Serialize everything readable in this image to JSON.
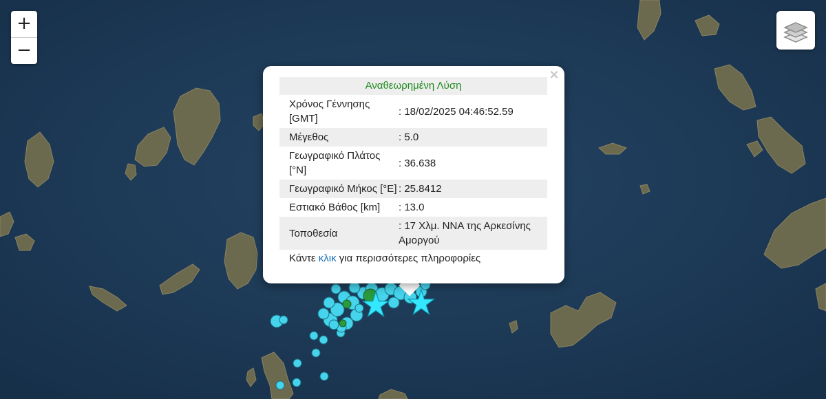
{
  "colors": {
    "sea": "#1d3a56",
    "land": "#6c6a4e",
    "quake_marker": "#45d4ec",
    "quake_marker_alt": "#2a9a3e",
    "star": "#35e6ff",
    "popup_title": "#1f8a1f",
    "link": "#1b6fb5"
  },
  "icons": {
    "zoom_in": "plus-icon",
    "zoom_out": "minus-icon",
    "layers": "layers-icon",
    "close": "close-icon",
    "epicenter": "star-icon"
  },
  "controls": {
    "zoom_in_label": "+",
    "zoom_out_label": "−"
  },
  "popup": {
    "close_label": "×",
    "title": "Αναθεωρημένη Λύση",
    "rows": [
      {
        "label": "Χρόνος Γέννησης [GMT]",
        "value": ": 18/02/2025 04:46:52.59"
      },
      {
        "label": "Μέγεθος",
        "value": ": 5.0"
      },
      {
        "label": "Γεωγραφικό Πλάτος [°N]",
        "value": ": 36.638"
      },
      {
        "label": "Γεωγραφικό Μήκος [°E]",
        "value": ": 25.8412"
      },
      {
        "label": "Εστιακό Βάθος [km]",
        "value": ": 13.0"
      },
      {
        "label": "Τοποθεσία",
        "value": ": 17 Χλμ. ΝΝΑ της Αρκεσίνης Αμοργού"
      }
    ],
    "footer_prefix": "Κάντε",
    "footer_link": "κλικ",
    "footer_suffix": "για περισσότερες πληροφορίες"
  }
}
